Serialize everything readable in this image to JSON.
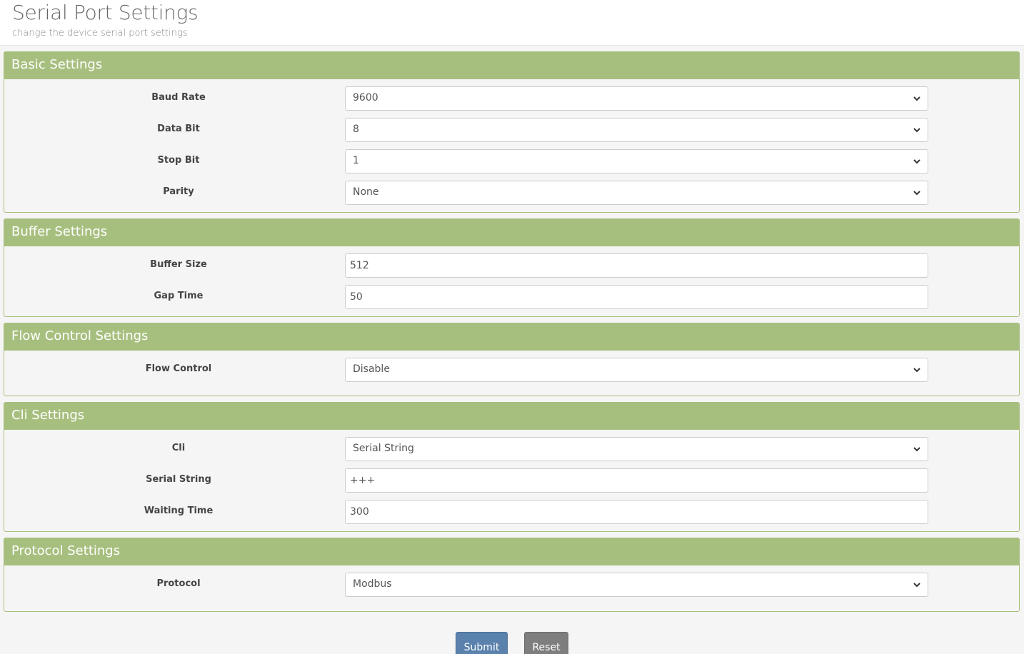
{
  "header": {
    "title": "Serial Port Settings",
    "subtitle": "change the device serial port settings"
  },
  "colors": {
    "panel_header": "#a7bf7e",
    "submit_button": "#5b82ad",
    "reset_button": "#7e7e7e"
  },
  "basic": {
    "heading": "Basic Settings",
    "baud_rate": {
      "label": "Baud Rate",
      "value": "9600"
    },
    "data_bit": {
      "label": "Data Bit",
      "value": "8"
    },
    "stop_bit": {
      "label": "Stop Bit",
      "value": "1"
    },
    "parity": {
      "label": "Parity",
      "value": "None"
    }
  },
  "buffer": {
    "heading": "Buffer Settings",
    "buffer_size": {
      "label": "Buffer Size",
      "value": "512"
    },
    "gap_time": {
      "label": "Gap Time",
      "value": "50"
    }
  },
  "flow": {
    "heading": "Flow Control Settings",
    "flow_control": {
      "label": "Flow Control",
      "value": "Disable"
    }
  },
  "cli": {
    "heading": "Cli Settings",
    "cli": {
      "label": "Cli",
      "value": "Serial String"
    },
    "serial_string": {
      "label": "Serial String",
      "value": "+++"
    },
    "waiting_time": {
      "label": "Waiting Time",
      "value": "300"
    }
  },
  "protocol": {
    "heading": "Protocol Settings",
    "protocol": {
      "label": "Protocol",
      "value": "Modbus"
    }
  },
  "actions": {
    "submit_label": "Submit",
    "reset_label": "Reset"
  }
}
